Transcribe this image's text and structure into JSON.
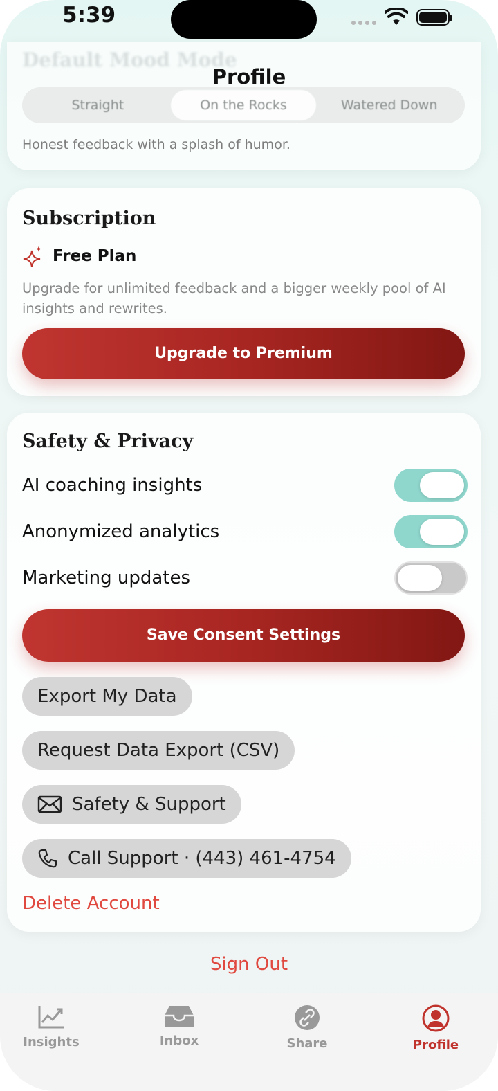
{
  "status_bar": {
    "time": "5:39"
  },
  "page_title": "Profile",
  "mood": {
    "heading": "Default Mood Mode",
    "options": [
      "Straight",
      "On the Rocks",
      "Watered Down"
    ],
    "selected": "On the Rocks",
    "description": "Honest feedback with a splash of humor."
  },
  "subscription": {
    "title": "Subscription",
    "plan_icon": "sparkles-icon",
    "plan_name": "Free Plan",
    "description": "Upgrade for unlimited feedback and a bigger weekly pool of AI insights and rewrites.",
    "upgrade_label": "Upgrade to Premium"
  },
  "privacy": {
    "title": "Safety & Privacy",
    "toggles": [
      {
        "label": "AI coaching insights",
        "on": true
      },
      {
        "label": "Anonymized analytics",
        "on": true
      },
      {
        "label": "Marketing updates",
        "on": false
      }
    ],
    "save_label": "Save Consent Settings",
    "export_label": "Export My Data",
    "csv_label": "Request Data Export (CSV)",
    "support_label": "Safety & Support",
    "call_label": "Call Support · (443) 461-4754",
    "delete_label": "Delete Account"
  },
  "sign_out_label": "Sign Out",
  "tabs": [
    {
      "label": "Insights",
      "icon": "chart-icon"
    },
    {
      "label": "Inbox",
      "icon": "inbox-icon"
    },
    {
      "label": "Share",
      "icon": "link-icon"
    },
    {
      "label": "Profile",
      "icon": "person-icon",
      "active": true
    }
  ],
  "colors": {
    "accent": "#c0332c",
    "toggle_on": "#8fd6cc",
    "link_red": "#e0493f"
  }
}
